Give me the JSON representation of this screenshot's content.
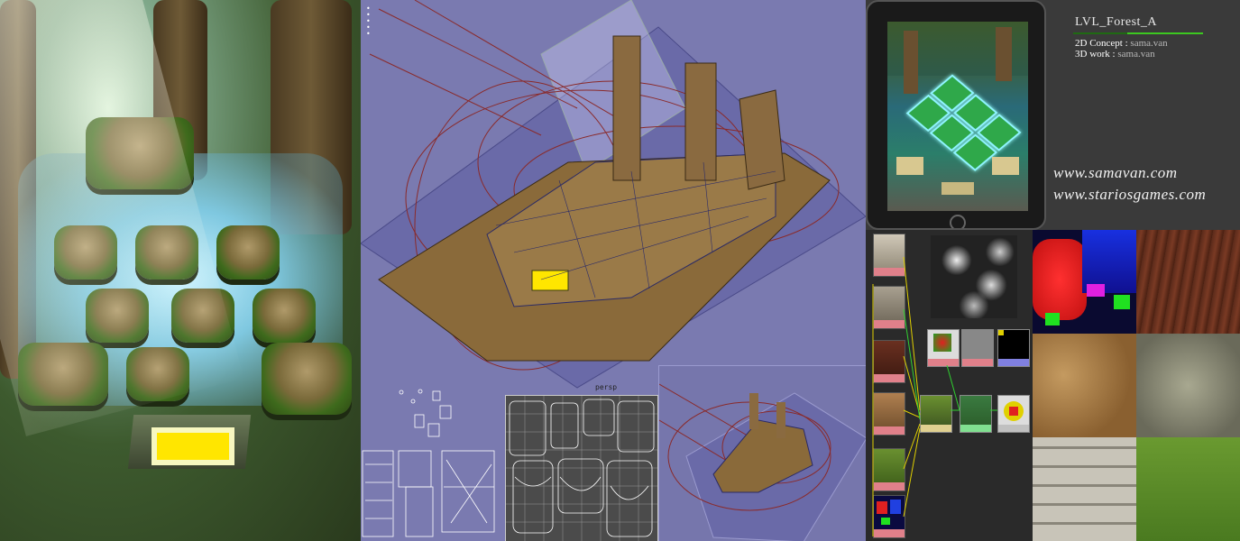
{
  "credits": {
    "title": "LVL_Forest_A",
    "concept_label": "2D Concept :",
    "concept_value": "sama.van",
    "work_label": "3D work :",
    "work_value": "sama.van",
    "urls": [
      "www.samavan.com",
      "www.stariosgames.com"
    ]
  },
  "viewport": {
    "persp_label": "persp"
  },
  "colors": {
    "viewport_bg": "#7a7ab0",
    "accent_green": "#3cc820",
    "gold": "#ffe600",
    "credits_bg": "#3a3a3a"
  }
}
